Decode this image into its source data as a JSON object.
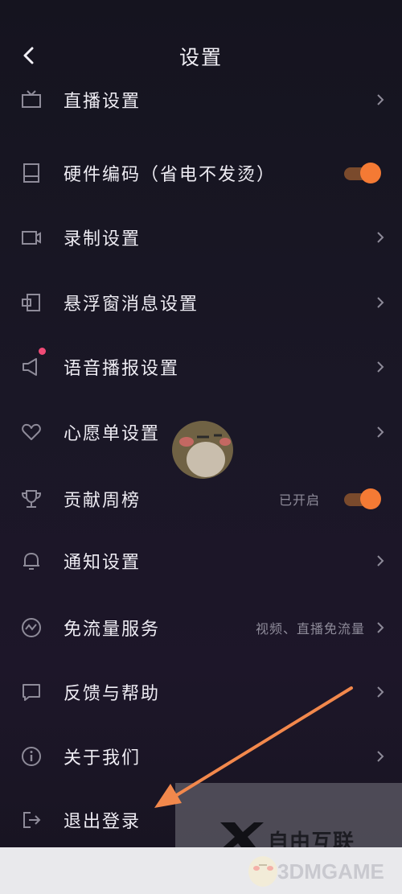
{
  "header": {
    "title": "设置"
  },
  "rows": [
    {
      "label": "直播设置",
      "icon": "tv-icon"
    },
    {
      "label": "硬件编码（省电不发烫）",
      "icon": "chip-icon",
      "toggle": "on"
    },
    {
      "label": "录制设置",
      "icon": "camera-icon"
    },
    {
      "label": "悬浮窗消息设置",
      "icon": "floating-window-icon"
    },
    {
      "label": "语音播报设置",
      "icon": "speaker-icon",
      "badge": "red-dot"
    },
    {
      "label": "心愿单设置",
      "icon": "heart-icon"
    },
    {
      "label": "贡献周榜",
      "icon": "trophy-icon",
      "value": "已开启",
      "toggle": "on"
    },
    {
      "label": "通知设置",
      "icon": "bell-icon"
    },
    {
      "label": "免流量服务",
      "icon": "data-saver-icon",
      "value": "视频、直播免流量"
    },
    {
      "label": "反馈与帮助",
      "icon": "feedback-icon"
    },
    {
      "label": "关于我们",
      "icon": "info-icon"
    },
    {
      "label": "退出登录",
      "icon": "logout-icon"
    }
  ],
  "watermark": {
    "brand": "自由互联",
    "site": "3DMGAME"
  },
  "colors": {
    "accent": "#f47a34",
    "background": "#1a1726",
    "badge": "#f04a76"
  }
}
